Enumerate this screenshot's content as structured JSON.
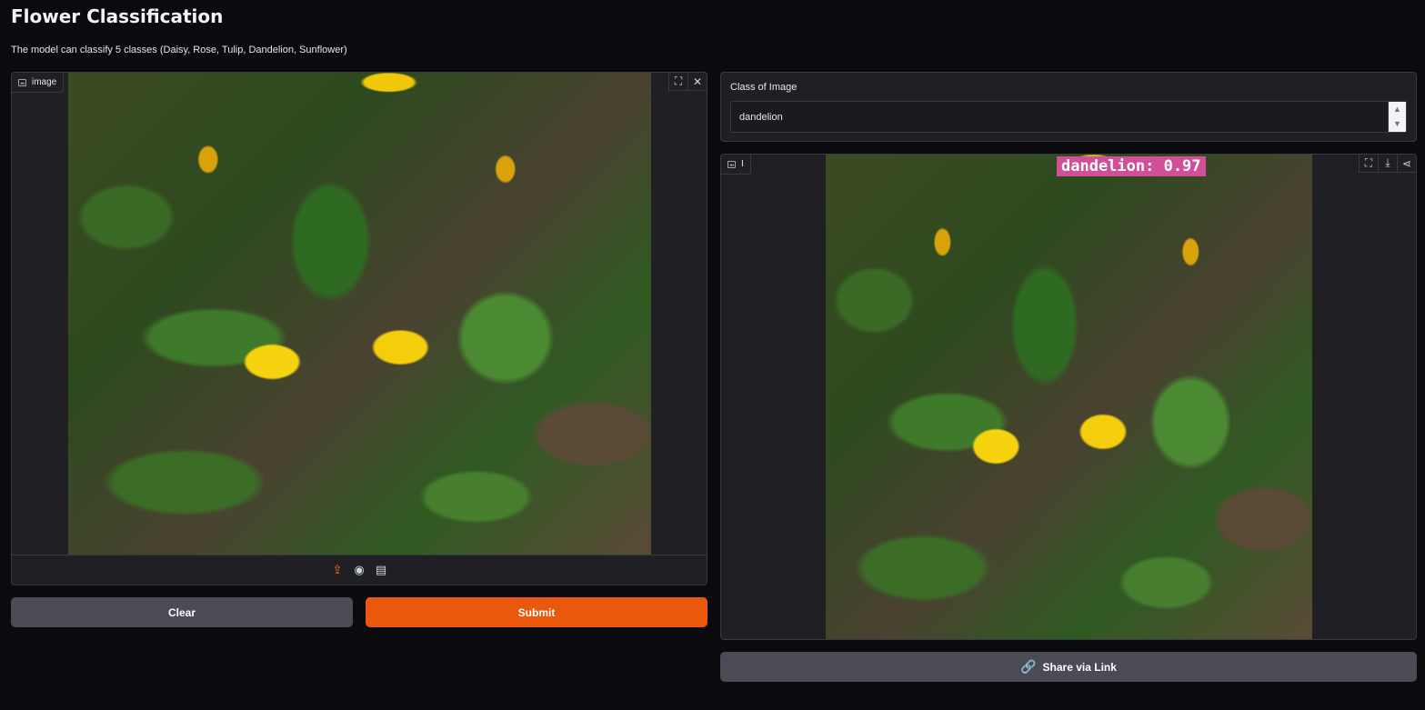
{
  "header": {
    "title": "Flower Classification",
    "description": "The model can classify 5 classes (Daisy, Rose, Tulip, Dandelion, Sunflower)"
  },
  "input_image": {
    "label": "image",
    "icons": [
      "image-icon",
      "fullscreen-icon",
      "close-icon"
    ],
    "sources": [
      "upload-icon",
      "webcam-icon",
      "clipboard-icon"
    ]
  },
  "buttons": {
    "clear": "Clear",
    "submit": "Submit",
    "share": "Share via Link"
  },
  "output_class": {
    "label": "Class of Image",
    "value": "dandelion"
  },
  "output_image": {
    "label": "I",
    "overlay_text": "dandelion:  0.97",
    "icons": [
      "fullscreen-icon",
      "download-icon",
      "share-icon"
    ]
  },
  "colors": {
    "accent": "#ea580c",
    "background": "#0b0b0f",
    "panel": "#1f1f24",
    "label_overlay": "#d04f97"
  }
}
